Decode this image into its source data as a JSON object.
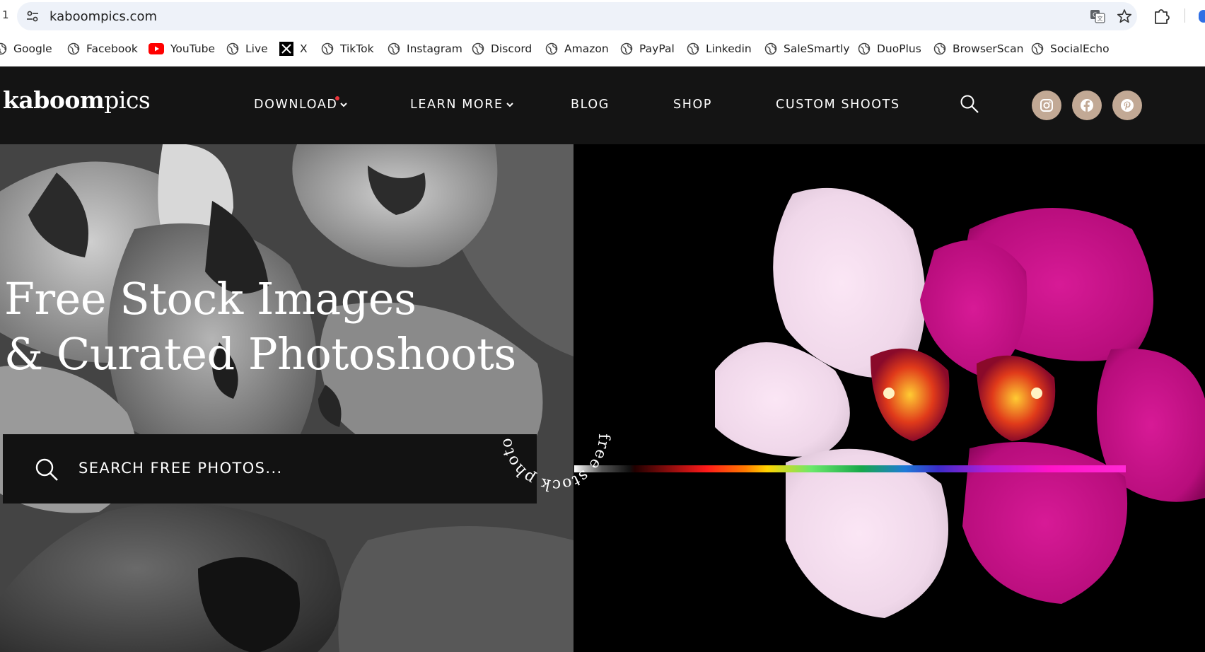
{
  "browser": {
    "tab_number": "1",
    "url": "kaboompics.com",
    "bookmarks": [
      {
        "label": "Google",
        "icon": "globe-icon"
      },
      {
        "label": "Facebook",
        "icon": "globe-icon"
      },
      {
        "label": "YouTube",
        "icon": "youtube-icon"
      },
      {
        "label": "Live",
        "icon": "globe-icon"
      },
      {
        "label": "X",
        "icon": "x-icon"
      },
      {
        "label": "TikTok",
        "icon": "globe-icon"
      },
      {
        "label": "Instagram",
        "icon": "globe-icon"
      },
      {
        "label": "Discord",
        "icon": "globe-icon"
      },
      {
        "label": "Amazon",
        "icon": "globe-icon"
      },
      {
        "label": "PayPal",
        "icon": "globe-icon"
      },
      {
        "label": "Linkedin",
        "icon": "globe-icon"
      },
      {
        "label": "SaleSmartly",
        "icon": "globe-icon"
      },
      {
        "label": "DuoPlus",
        "icon": "globe-icon"
      },
      {
        "label": "BrowserScan",
        "icon": "globe-icon"
      },
      {
        "label": "SocialEcho",
        "icon": "globe-icon"
      }
    ]
  },
  "site": {
    "logo_bold": "kaboom",
    "logo_light": "pics",
    "nav": {
      "download": "DOWNLOAD",
      "learn_more": "LEARN MORE",
      "blog": "BLOG",
      "shop": "SHOP",
      "custom_shoots": "CUSTOM SHOOTS"
    },
    "social": [
      "instagram-icon",
      "facebook-icon",
      "pinterest-icon"
    ],
    "accent_color": "#c2a995",
    "notification_color": "#e9353b"
  },
  "hero": {
    "headline_line1": "Free Stock Images",
    "headline_line2": "& Curated Photoshoots",
    "search_placeholder": "SEARCH FREE PHOTOS...",
    "badge_text": "free stock photography"
  }
}
